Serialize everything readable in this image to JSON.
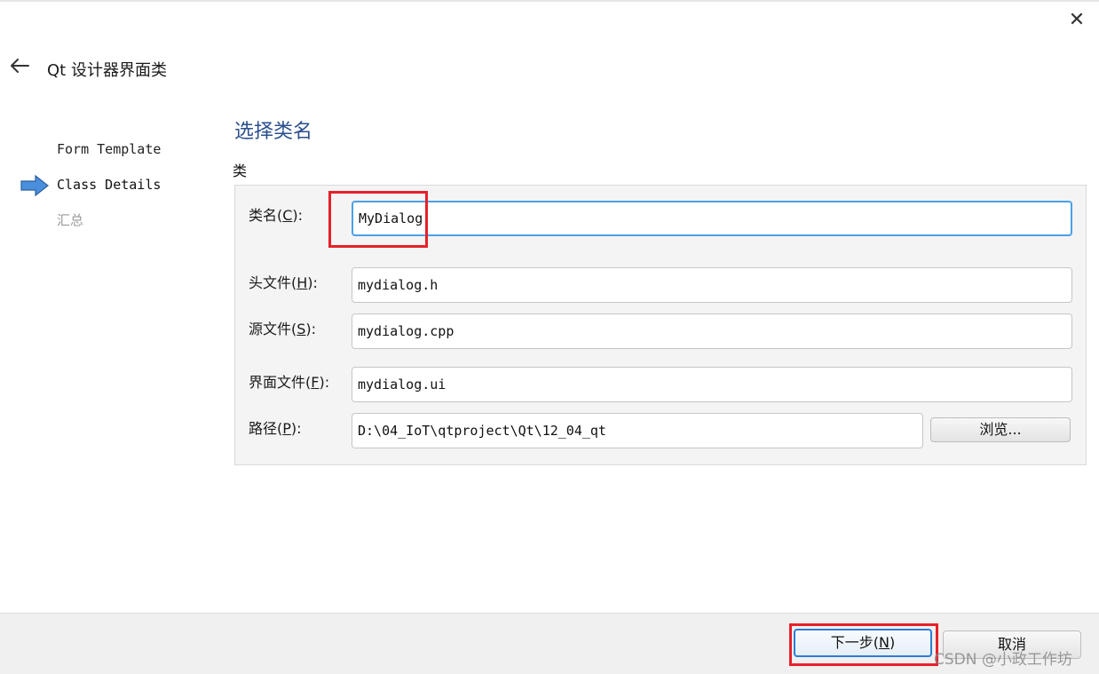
{
  "window": {
    "title": "Qt 设计器界面类",
    "close_label": "✕"
  },
  "steps": [
    {
      "label": "Form Template",
      "state": "done"
    },
    {
      "label": "Class Details",
      "state": "current"
    },
    {
      "label": "汇总",
      "state": "pending"
    }
  ],
  "page": {
    "heading": "选择类名",
    "group_title": "类"
  },
  "fields": {
    "class_name": {
      "label_pre": "类名(",
      "accel": "C",
      "label_post": "):",
      "value": "MyDialog"
    },
    "header_file": {
      "label_pre": "头文件(",
      "accel": "H",
      "label_post": "):",
      "value": "mydialog.h"
    },
    "source_file": {
      "label_pre": "源文件(",
      "accel": "S",
      "label_post": "):",
      "value": "mydialog.cpp"
    },
    "form_file": {
      "label_pre": "界面文件(",
      "accel": "F",
      "label_post": "):",
      "value": "mydialog.ui"
    },
    "path": {
      "label_pre": "路径(",
      "accel": "P",
      "label_post": "):",
      "value": "D:\\04_IoT\\qtproject\\Qt\\12_04_qt"
    }
  },
  "buttons": {
    "browse": "浏览...",
    "next_pre": "下一步(",
    "next_accel": "N",
    "next_post": ")",
    "cancel": "取消"
  },
  "watermark": "CSDN @小政工作坊",
  "colors": {
    "heading": "#2b4f8e",
    "focus": "#4aa0e6",
    "highlight": "#e8202a",
    "step_arrow": "#4a8fdc"
  }
}
